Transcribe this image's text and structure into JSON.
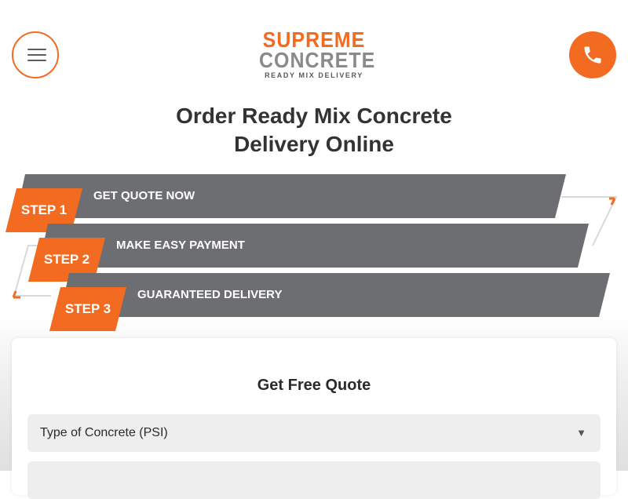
{
  "header": {
    "menu_icon": "hamburger-icon",
    "phone_icon": "phone-icon",
    "logo": {
      "line1": "SUPREME",
      "line2": "CONCRETE",
      "tagline": "READY MIX DELIVERY"
    }
  },
  "hero": {
    "title_line1": "Order Ready Mix Concrete",
    "title_line2": "Delivery Online"
  },
  "steps": [
    {
      "badge": "STEP 1",
      "text": "GET QUOTE NOW"
    },
    {
      "badge": "STEP 2",
      "text": "MAKE EASY PAYMENT"
    },
    {
      "badge": "STEP 3",
      "text": "GUARANTEED DELIVERY"
    }
  ],
  "quote_form": {
    "title": "Get Free Quote",
    "concrete_type_select": "Type of Concrete (PSI)"
  },
  "colors": {
    "accent": "#f26b21",
    "step_bar": "#6d6e71",
    "heading": "#333333"
  }
}
